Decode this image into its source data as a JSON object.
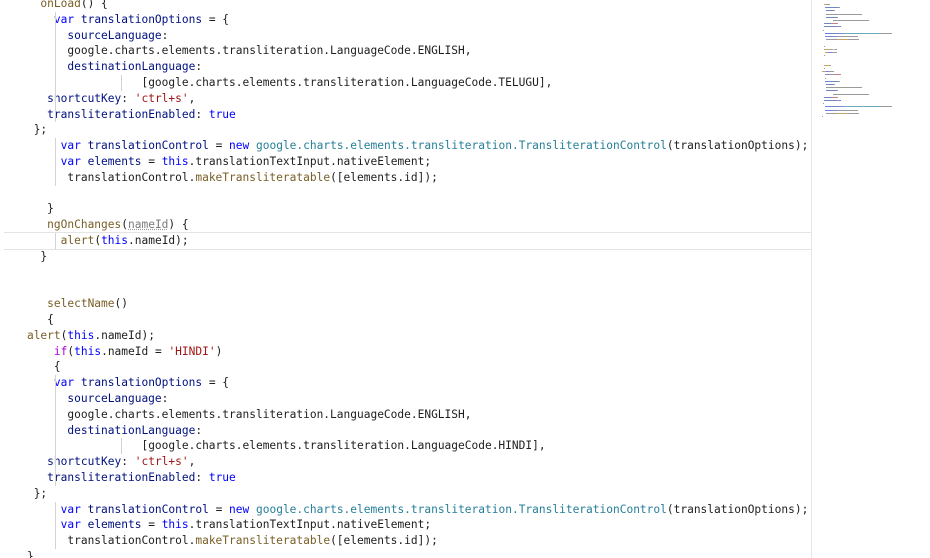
{
  "editor": {
    "lines": [
      {
        "indent": 6,
        "tokens": [
          [
            "onLoad",
            "fn"
          ],
          [
            "() {",
            "pun"
          ]
        ]
      },
      {
        "indent": 8,
        "tokens": [
          [
            "var ",
            "kw"
          ],
          [
            "translationOptions",
            "var"
          ],
          [
            " = {",
            "pun"
          ]
        ]
      },
      {
        "indent": 10,
        "tokens": [
          [
            "sourceLanguage",
            "var"
          ],
          [
            ":",
            "pun"
          ]
        ]
      },
      {
        "indent": 10,
        "tokens": [
          [
            "google.charts.elements.transliteration.LanguageCode.ENGLISH,",
            "pun"
          ]
        ]
      },
      {
        "indent": 10,
        "tokens": [
          [
            "destinationLanguage",
            "var"
          ],
          [
            ":",
            "pun"
          ]
        ]
      },
      {
        "indent": 21,
        "tokens": [
          [
            "[google.charts.elements.transliteration.LanguageCode.TELUGU],",
            "pun"
          ]
        ]
      },
      {
        "indent": 7,
        "tokens": [
          [
            "shortcutKey",
            "var"
          ],
          [
            ": ",
            "pun"
          ],
          [
            "'ctrl+s'",
            "str"
          ],
          [
            ",",
            "pun"
          ]
        ]
      },
      {
        "indent": 7,
        "tokens": [
          [
            "transliterationEnabled",
            "var"
          ],
          [
            ": ",
            "pun"
          ],
          [
            "true",
            "kw"
          ]
        ]
      },
      {
        "indent": 5,
        "tokens": [
          [
            "};",
            "pun"
          ]
        ]
      },
      {
        "indent": 9,
        "tokens": [
          [
            "var ",
            "kw"
          ],
          [
            "translationControl",
            "var"
          ],
          [
            " = ",
            "pun"
          ],
          [
            "new ",
            "kw"
          ],
          [
            "google.charts.elements.transliteration.",
            "type"
          ],
          [
            "TransliterationControl",
            "type"
          ],
          [
            "(translationOptions);",
            "pun"
          ]
        ]
      },
      {
        "indent": 9,
        "tokens": [
          [
            "var ",
            "kw"
          ],
          [
            "elements",
            "var"
          ],
          [
            " = ",
            "pun"
          ],
          [
            "this",
            "kw"
          ],
          [
            ".translationTextInput.nativeElement;",
            "pun"
          ]
        ]
      },
      {
        "indent": 10,
        "tokens": [
          [
            "translationControl.",
            "pun"
          ],
          [
            "makeTransliteratable",
            "fn"
          ],
          [
            "([elements.id]);",
            "pun"
          ]
        ]
      },
      {
        "indent": 0,
        "tokens": []
      },
      {
        "indent": 7,
        "tokens": [
          [
            "}",
            "pun"
          ]
        ]
      },
      {
        "indent": 7,
        "tokens": [
          [
            "ngOnChanges",
            "fn"
          ],
          [
            "(",
            "pun"
          ],
          [
            "nameId",
            "hint"
          ],
          [
            ") {",
            "pun"
          ]
        ]
      },
      {
        "indent": 9,
        "tokens": [
          [
            "alert",
            "fn"
          ],
          [
            "(",
            "pun"
          ],
          [
            "this",
            "kw"
          ],
          [
            ".nameId);",
            "pun"
          ]
        ]
      },
      {
        "indent": 6,
        "tokens": [
          [
            "}",
            "pun"
          ]
        ]
      },
      {
        "indent": 0,
        "tokens": []
      },
      {
        "indent": 0,
        "tokens": []
      },
      {
        "indent": 7,
        "tokens": [
          [
            "selectName",
            "fn"
          ],
          [
            "()",
            "pun"
          ]
        ]
      },
      {
        "indent": 7,
        "tokens": [
          [
            "{",
            "pun"
          ]
        ]
      },
      {
        "indent": 4,
        "tokens": [
          [
            "alert",
            "fn"
          ],
          [
            "(",
            "pun"
          ],
          [
            "this",
            "kw"
          ],
          [
            ".nameId);",
            "pun"
          ]
        ]
      },
      {
        "indent": 8,
        "tokens": [
          [
            "if",
            "ctl"
          ],
          [
            "(",
            "pun"
          ],
          [
            "this",
            "kw"
          ],
          [
            ".nameId = ",
            "pun"
          ],
          [
            "'HINDI'",
            "str"
          ],
          [
            ")",
            "pun"
          ]
        ]
      },
      {
        "indent": 8,
        "tokens": [
          [
            "{",
            "pun"
          ]
        ]
      },
      {
        "indent": 8,
        "tokens": [
          [
            "var ",
            "kw"
          ],
          [
            "translationOptions",
            "var"
          ],
          [
            " = {",
            "pun"
          ]
        ]
      },
      {
        "indent": 10,
        "tokens": [
          [
            "sourceLanguage",
            "var"
          ],
          [
            ":",
            "pun"
          ]
        ]
      },
      {
        "indent": 10,
        "tokens": [
          [
            "google.charts.elements.transliteration.LanguageCode.ENGLISH,",
            "pun"
          ]
        ]
      },
      {
        "indent": 10,
        "tokens": [
          [
            "destinationLanguage",
            "var"
          ],
          [
            ":",
            "pun"
          ]
        ]
      },
      {
        "indent": 21,
        "tokens": [
          [
            "[google.charts.elements.transliteration.LanguageCode.HINDI],",
            "pun"
          ]
        ]
      },
      {
        "indent": 7,
        "tokens": [
          [
            "shortcutKey",
            "var"
          ],
          [
            ": ",
            "pun"
          ],
          [
            "'ctrl+s'",
            "str"
          ],
          [
            ",",
            "pun"
          ]
        ]
      },
      {
        "indent": 7,
        "tokens": [
          [
            "transliterationEnabled",
            "var"
          ],
          [
            ": ",
            "pun"
          ],
          [
            "true",
            "kw"
          ]
        ]
      },
      {
        "indent": 5,
        "tokens": [
          [
            "};",
            "pun"
          ]
        ]
      },
      {
        "indent": 9,
        "tokens": [
          [
            "var ",
            "kw"
          ],
          [
            "translationControl",
            "var"
          ],
          [
            " = ",
            "pun"
          ],
          [
            "new ",
            "kw"
          ],
          [
            "google.charts.elements.transliteration.",
            "type"
          ],
          [
            "TransliterationControl",
            "type"
          ],
          [
            "(translationOptions);",
            "pun"
          ]
        ]
      },
      {
        "indent": 9,
        "tokens": [
          [
            "var ",
            "kw"
          ],
          [
            "elements",
            "var"
          ],
          [
            " = ",
            "pun"
          ],
          [
            "this",
            "kw"
          ],
          [
            ".translationTextInput.nativeElement;",
            "pun"
          ]
        ]
      },
      {
        "indent": 10,
        "tokens": [
          [
            "translationControl.",
            "pun"
          ],
          [
            "makeTransliteratable",
            "fn"
          ],
          [
            "([elements.id]);",
            "pun"
          ]
        ]
      },
      {
        "indent": 4,
        "tokens": [
          [
            "}",
            "pun"
          ]
        ]
      }
    ],
    "current_line_index": 15
  }
}
